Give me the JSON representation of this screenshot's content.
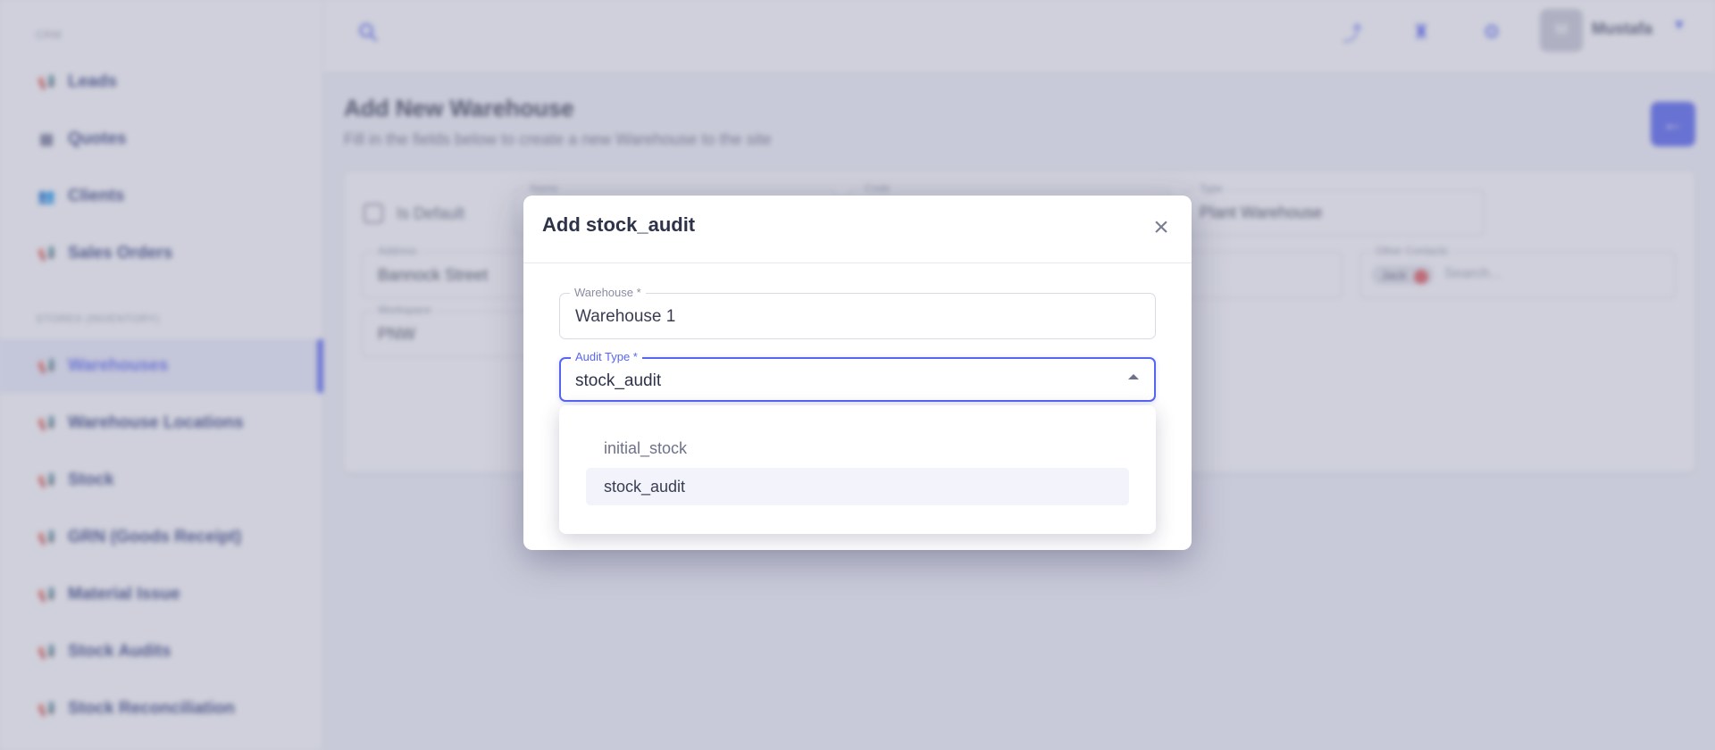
{
  "sidebar": {
    "section_crm": "CRM",
    "section_stores": "STORES (INVENTORY)",
    "crm_items": [
      {
        "label": "Leads",
        "icon": "megaphone-icon"
      },
      {
        "label": "Quotes",
        "icon": "document-icon"
      },
      {
        "label": "Clients",
        "icon": "users-icon"
      },
      {
        "label": "Sales Orders",
        "icon": "megaphone-icon"
      }
    ],
    "store_items": [
      {
        "label": "Warehouses",
        "icon": "megaphone-icon",
        "active": true
      },
      {
        "label": "Warehouse Locations",
        "icon": "megaphone-icon"
      },
      {
        "label": "Stock",
        "icon": "megaphone-icon"
      },
      {
        "label": "GRN (Goods Receipt)",
        "icon": "megaphone-icon"
      },
      {
        "label": "Material Issue",
        "icon": "megaphone-icon"
      },
      {
        "label": "Stock Audits",
        "icon": "megaphone-icon"
      },
      {
        "label": "Stock Reconciliation",
        "icon": "megaphone-icon"
      }
    ]
  },
  "topbar": {
    "user_initial": "M",
    "user_name": "Mustafa"
  },
  "page": {
    "title": "Add New Warehouse",
    "subtitle": "Fill in the fields below to create a new Warehouse to the site",
    "form": {
      "is_default_label": "Is Default",
      "name_label": "Name",
      "code_label": "Code",
      "type_label": "Type",
      "type_value": "Plant Warehouse",
      "address_label": "Address",
      "address_value": "Bannock Street",
      "other_contacts_label": "Other Contacts",
      "contact_chip": "Jack",
      "search_placeholder": "Search...",
      "workspace_label": "Workspace",
      "workspace_value": "PNW"
    }
  },
  "modal": {
    "title": "Add stock_audit",
    "close_icon": "close-icon",
    "warehouse": {
      "label": "Warehouse *",
      "value": "Warehouse 1"
    },
    "audit_type": {
      "label": "Audit Type *",
      "value": "stock_audit"
    }
  },
  "dropdown": {
    "options": [
      {
        "label": "initial_stock",
        "selected": false
      },
      {
        "label": "stock_audit",
        "selected": true
      }
    ]
  },
  "colors": {
    "accent": "#5865f2",
    "overlay": "#8c8eaa"
  }
}
